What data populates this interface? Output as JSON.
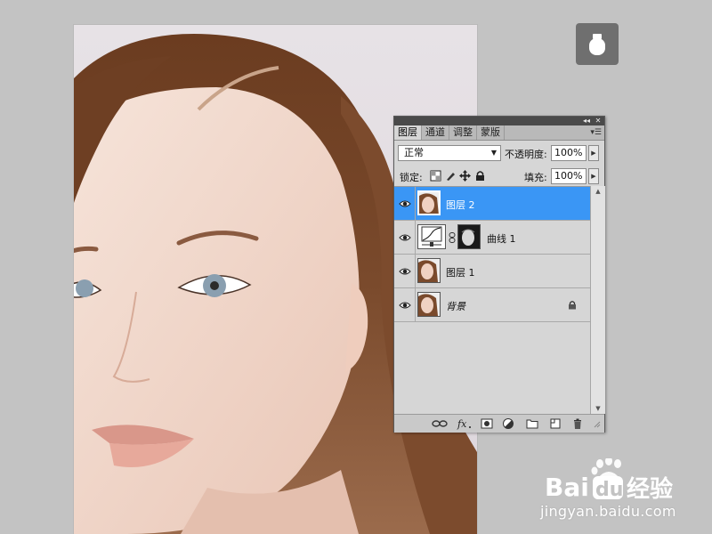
{
  "tabs": [
    "图层",
    "通道",
    "调整",
    "蒙版"
  ],
  "blend_mode": "正常",
  "opacity_label": "不透明度:",
  "opacity_value": "100%",
  "lock_label": "锁定:",
  "fill_label": "填充:",
  "fill_value": "100%",
  "layers": [
    {
      "name": "图层 2",
      "selected": true
    },
    {
      "name": "曲线 1",
      "selected": false
    },
    {
      "name": "图层 1",
      "selected": false
    },
    {
      "name": "背景",
      "selected": false,
      "locked": true
    }
  ],
  "watermark": {
    "brand_du": "du",
    "brand_jingyan": "经验",
    "url": "jingyan.baidu.com"
  },
  "colors": {
    "selection": "#3a96f5",
    "panel_bg": "#d6d6d6",
    "workspace_bg": "#c3c3c3"
  }
}
